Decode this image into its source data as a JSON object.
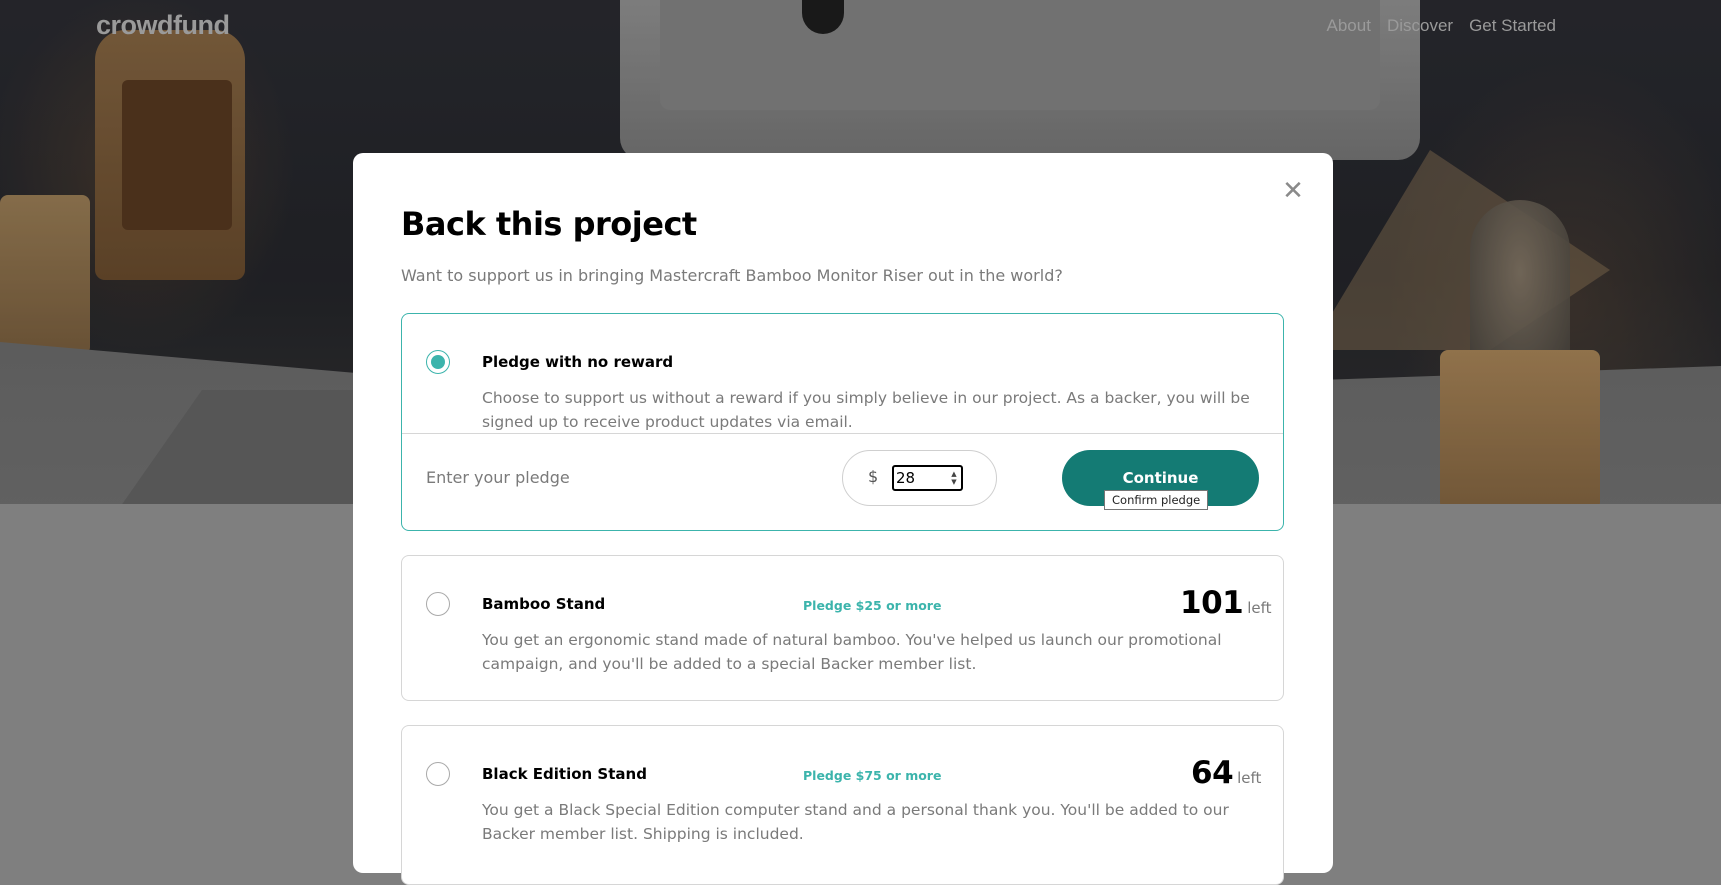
{
  "header": {
    "logo": "crowdfund",
    "nav": [
      "About",
      "Discover",
      "Get Started"
    ]
  },
  "modal": {
    "title": "Back this project",
    "subtitle": "Want to support us in bringing Mastercraft Bamboo Monitor Riser out in the world?",
    "close_icon": "close-icon"
  },
  "pledges": [
    {
      "name": "Pledge with no reward",
      "selected": true,
      "description": "Choose to support us without a reward if you simply believe in our project. As a backer, you will be signed up to receive product updates via email.",
      "enter_label": "Enter your pledge",
      "currency": "$",
      "amount": "28",
      "continue_label": "Continue",
      "tooltip": "Confirm pledge"
    },
    {
      "name": "Bamboo Stand",
      "selected": false,
      "pledge_min": "Pledge $25 or more",
      "left_count": "101",
      "left_word": "left",
      "description": "You get an ergonomic stand made of natural bamboo. You've helped us launch our promotional campaign, and you'll be added to a special Backer member list."
    },
    {
      "name": "Black Edition Stand",
      "selected": false,
      "pledge_min": "Pledge $75 or more",
      "left_count": "64",
      "left_word": "left",
      "description": "You get a Black Special Edition computer stand and a personal thank you. You'll be added to our Backer member list. Shipping is included."
    }
  ],
  "colors": {
    "accent": "#3cb4ac",
    "button": "#147b74",
    "overlay": "#7f7f7f"
  }
}
